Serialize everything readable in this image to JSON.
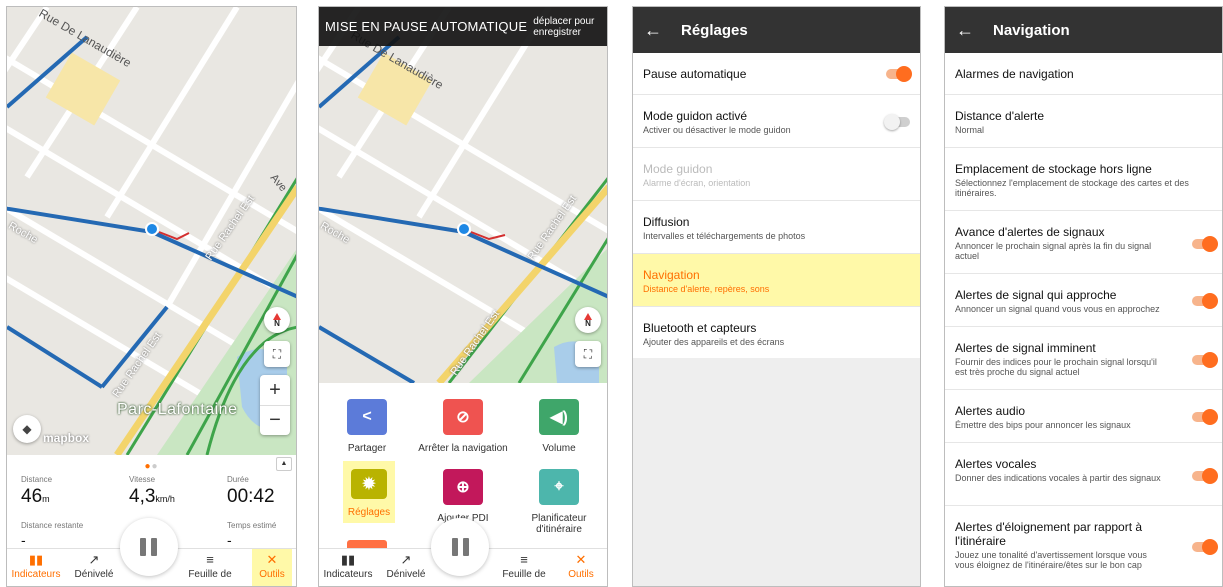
{
  "screen1": {
    "map": {
      "streets": [
        "Rue De Lanaudière",
        "Rue Rachel Est",
        "Rue Rachel Est",
        "Ave",
        "Roche"
      ],
      "park_label": "Parc-Lafontaine",
      "attribution": "mapbox",
      "compass_letter": "N",
      "zoom_in": "+",
      "zoom_out": "−"
    },
    "stats": {
      "distance": {
        "label": "Distance",
        "value": "46",
        "unit": "m"
      },
      "speed": {
        "label": "Vitesse",
        "value": "4,3",
        "unit": "km/h"
      },
      "duration": {
        "label": "Durée",
        "value": "00:42"
      },
      "remaining": {
        "label": "Distance restante",
        "value": "-"
      },
      "estimated": {
        "label": "Temps estimé",
        "value": "-"
      }
    },
    "nav": [
      "Indicateurs",
      "Dénivelé",
      "Feuille de",
      "Outils"
    ]
  },
  "screen2": {
    "banner": {
      "title": "MISE EN PAUSE AUTOMATIQUE",
      "hint": "déplacer pour enregistrer"
    },
    "map": {
      "streets": [
        "Rue De Lanaudière",
        "Rue Rachel Est",
        "Rue Rachel Est",
        "Roche"
      ],
      "compass_letter": "N"
    },
    "tools": [
      {
        "label": "Partager",
        "color": "#5c7bd9",
        "icon": "share-icon"
      },
      {
        "label": "Arrêter la navigation",
        "color": "#ef5350",
        "icon": "compass-icon"
      },
      {
        "label": "Volume",
        "color": "#3fa66a",
        "icon": "volume-icon"
      },
      {
        "label": "Réglages",
        "color": "#b9b300",
        "icon": "gear-icon"
      },
      {
        "label": "Ajouter PDI",
        "color": "#c2185b",
        "icon": "add-poi-icon"
      },
      {
        "label": "Planificateur d'itinéraire",
        "color": "#4db6ac",
        "icon": "route-planner-icon"
      }
    ],
    "nav": [
      "Indicateurs",
      "Dénivelé",
      "Feuille de",
      "Outils"
    ]
  },
  "screen3": {
    "header": {
      "title": "Réglages"
    },
    "rows": [
      {
        "title": "Pause automatique",
        "subtitle": "",
        "toggle": "on"
      },
      {
        "title": "Mode guidon activé",
        "subtitle": "Activer ou désactiver le mode guidon",
        "toggle": "off"
      },
      {
        "title": "Mode guidon",
        "subtitle": "Alarme d'écran, orientation"
      },
      {
        "title": "Diffusion",
        "subtitle": "Intervalles et téléchargements de photos"
      },
      {
        "title": "Navigation",
        "subtitle": "Distance d'alerte, repères, sons"
      },
      {
        "title": "Bluetooth et capteurs",
        "subtitle": "Ajouter des appareils et des écrans"
      }
    ]
  },
  "screen4": {
    "header": {
      "title": "Navigation"
    },
    "rows": [
      {
        "title": "Alarmes de navigation",
        "subtitle": ""
      },
      {
        "title": "Distance d'alerte",
        "subtitle": "Normal"
      },
      {
        "title": "Emplacement de stockage hors ligne",
        "subtitle": "Sélectionnez l'emplacement de stockage des cartes et des itinéraires."
      },
      {
        "title": "Avance d'alertes de signaux",
        "subtitle": "Annoncer le prochain signal après la fin du signal actuel",
        "toggle": "on"
      },
      {
        "title": "Alertes de signal qui approche",
        "subtitle": "Annoncer un signal quand vous vous en approchez",
        "toggle": "on"
      },
      {
        "title": "Alertes de signal imminent",
        "subtitle": "Fournir des indices pour le prochain signal lorsqu'il est très proche du signal actuel",
        "toggle": "on"
      },
      {
        "title": "Alertes audio",
        "subtitle": "Émettre des bips pour annoncer les signaux",
        "toggle": "on"
      },
      {
        "title": "Alertes vocales",
        "subtitle": "Donner des indications vocales à partir des signaux",
        "toggle": "on"
      },
      {
        "title": "Alertes d'éloignement par rapport à l'itinéraire",
        "subtitle": "Jouez une tonalité d'avertissement lorsque vous vous éloignez de l'itinéraire/êtes sur le bon cap",
        "toggle": "on"
      }
    ]
  }
}
